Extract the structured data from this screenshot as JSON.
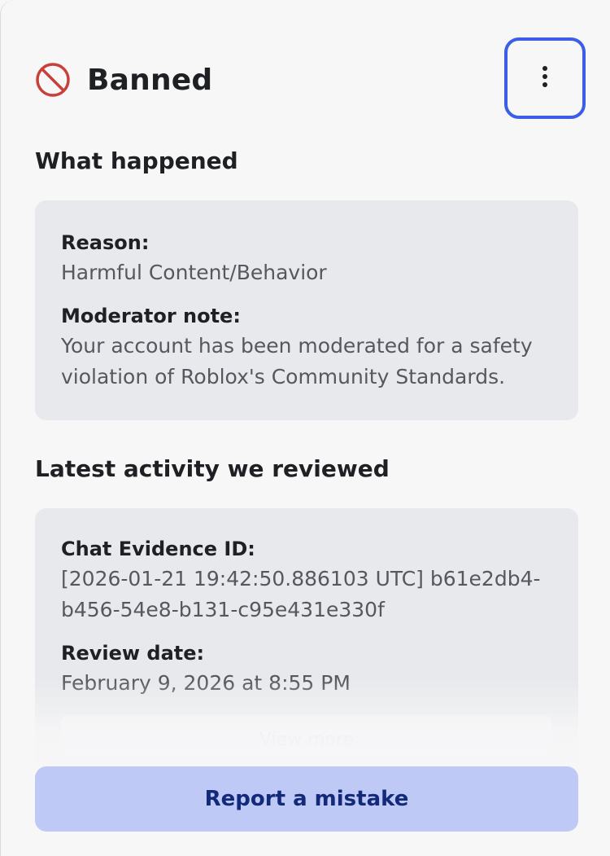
{
  "header": {
    "title": "Banned",
    "status_icon": "ban-icon",
    "more_icon": "more-vertical-icon",
    "accent_color": "#3a5ee8",
    "ban_color": "#c8403a"
  },
  "what_happened": {
    "title": "What happened",
    "reason_label": "Reason:",
    "reason_value": "Harmful Content/Behavior",
    "note_label": "Moderator note:",
    "note_value": "Your account has been moderated for a safety violation of Roblox's Community Standards."
  },
  "latest_activity": {
    "title": "Latest activity we reviewed",
    "evidence_label": "Chat Evidence ID:",
    "evidence_value_line1": "[2026-01-21 19:42:50.886103 UTC] b61e2db4-",
    "evidence_value_line2": "b456-54e8-b131-c95e431e330f",
    "review_label": "Review date:",
    "review_value": "February 9, 2026 at 8:55 PM",
    "view_more_label": "View more"
  },
  "footer": {
    "report_label": "Report a mistake"
  }
}
